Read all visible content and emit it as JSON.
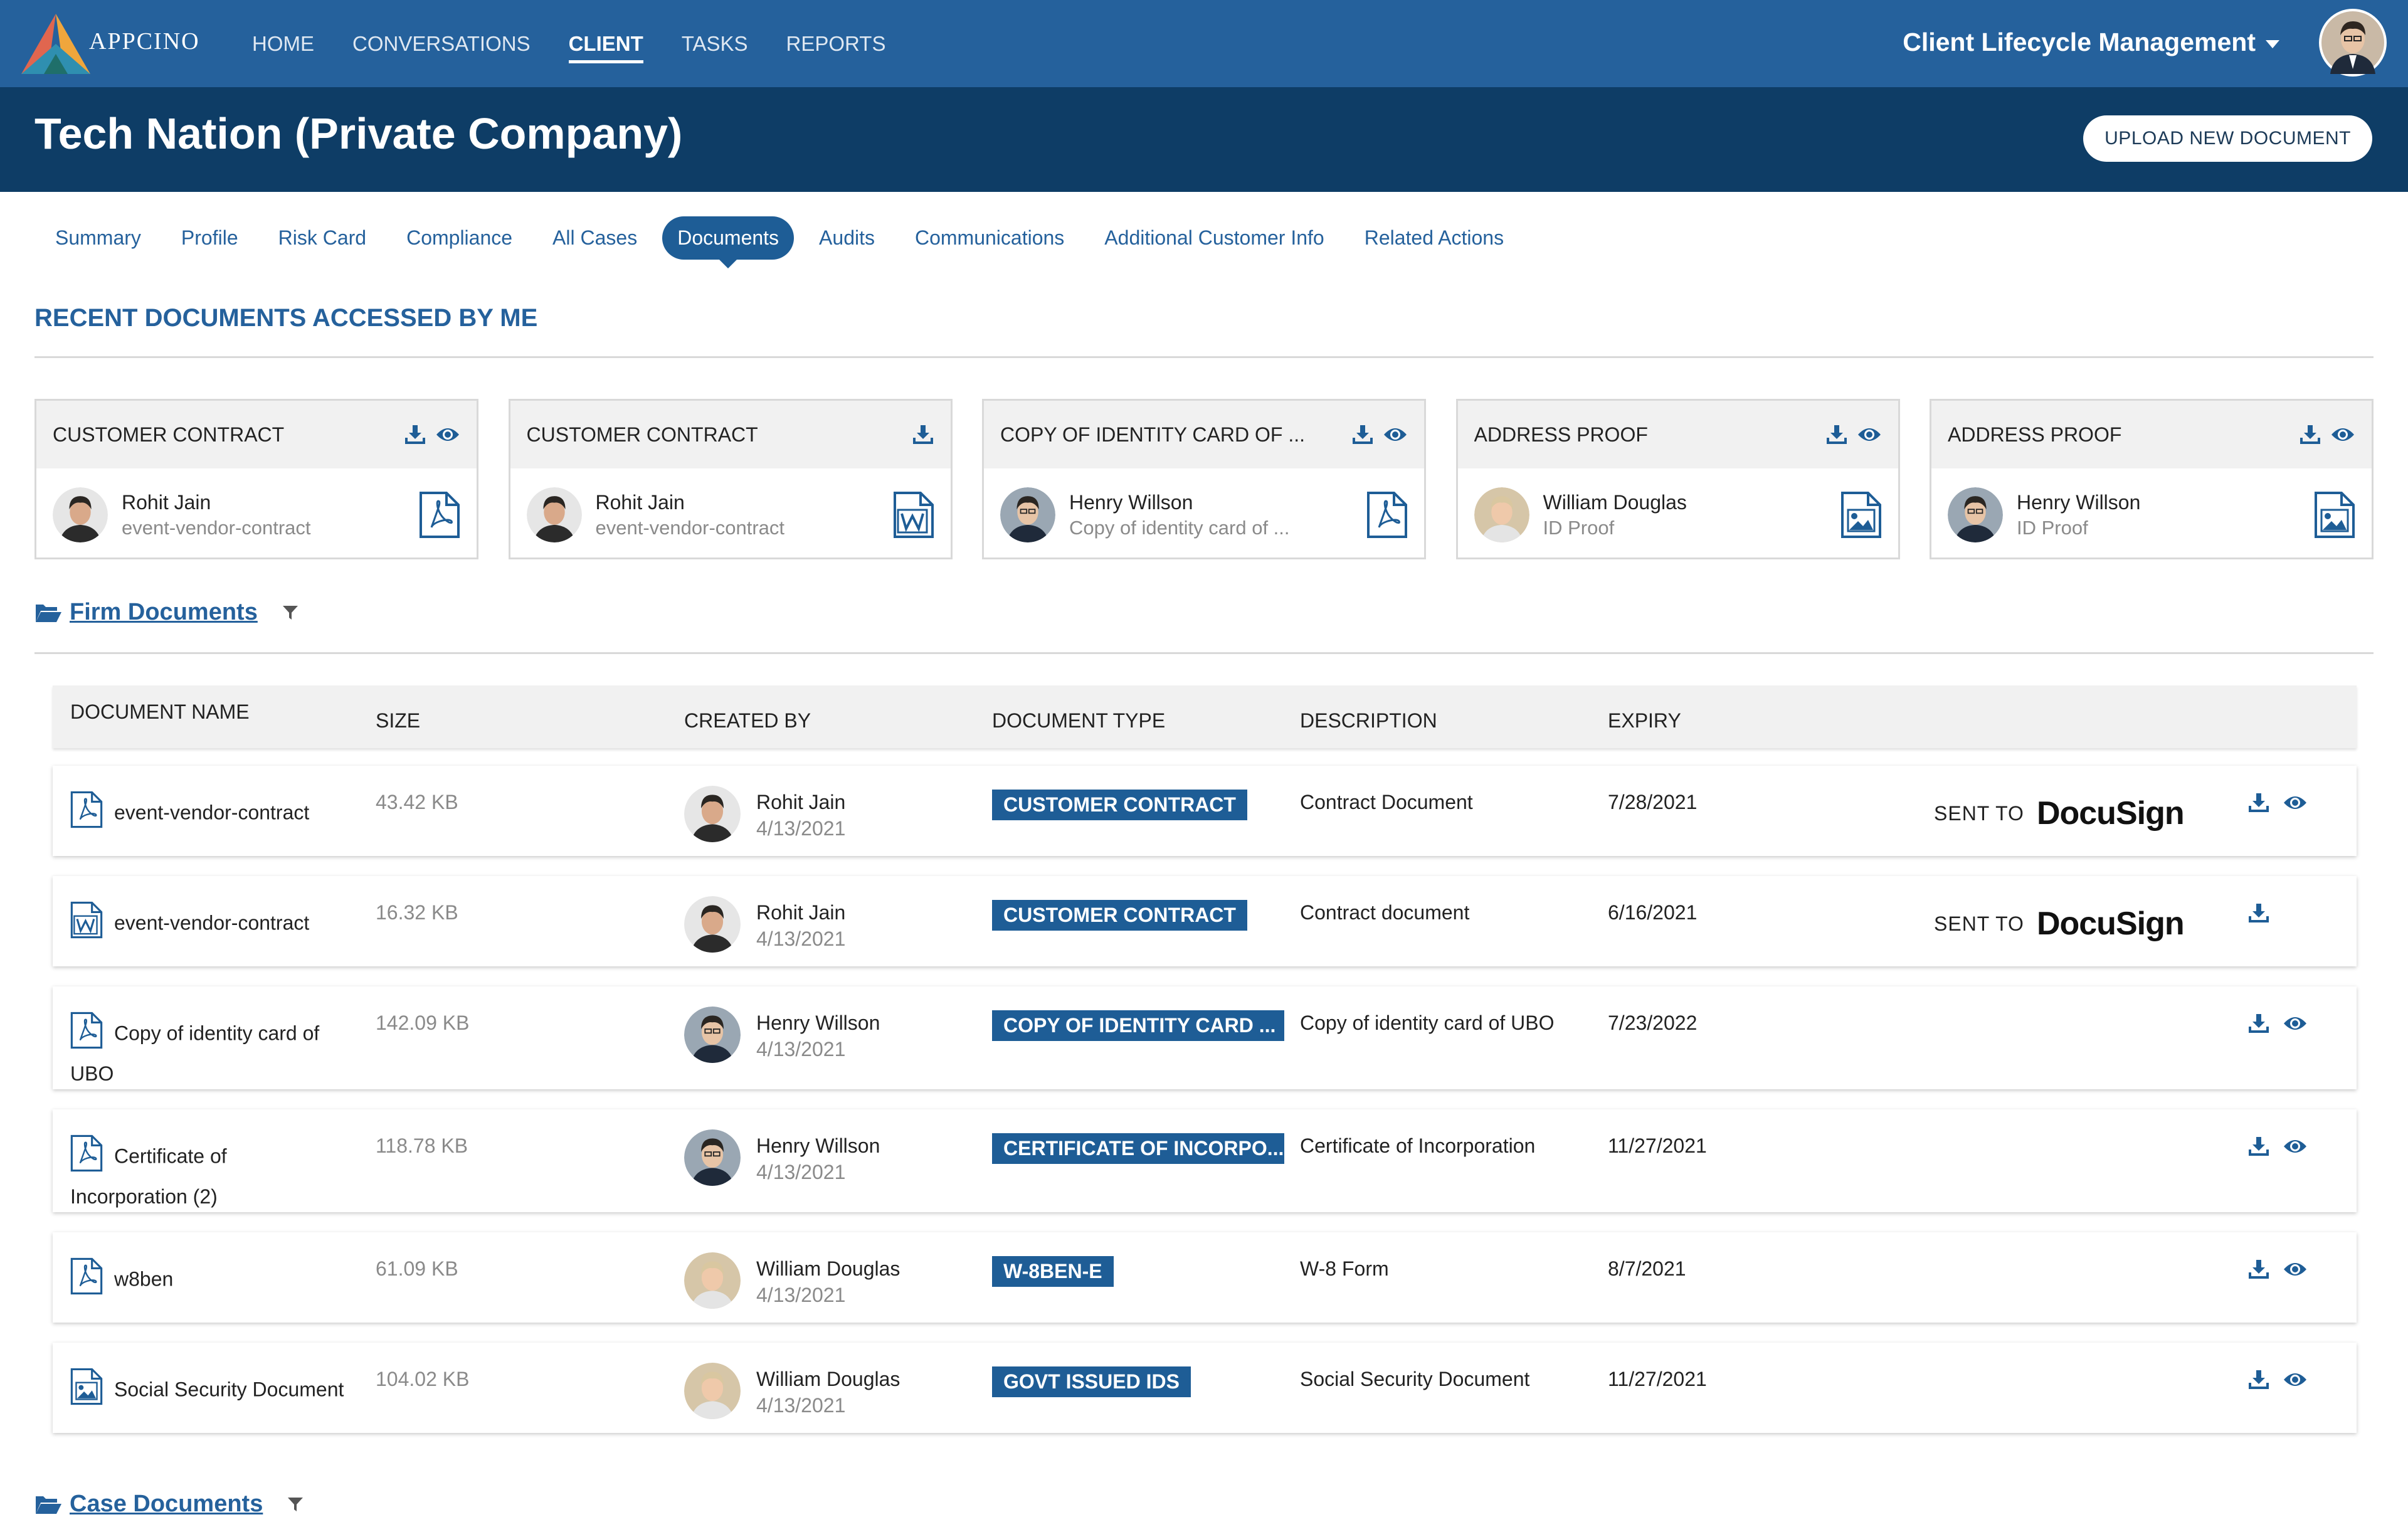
{
  "brand": {
    "name": "APPCINO"
  },
  "nav": [
    "HOME",
    "CONVERSATIONS",
    "CLIENT",
    "TASKS",
    "REPORTS"
  ],
  "app_switcher": "Client Lifecycle Management",
  "header": {
    "title": "Tech Nation (Private Company)",
    "upload_button": "UPLOAD NEW DOCUMENT"
  },
  "subtabs": [
    "Summary",
    "Profile",
    "Risk Card",
    "Compliance",
    "All Cases",
    "Documents",
    "Audits",
    "Communications",
    "Additional Customer Info",
    "Related Actions"
  ],
  "active_subtab": "Documents",
  "recent": {
    "title": "RECENT DOCUMENTS ACCESSED BY ME",
    "cards": [
      {
        "title": "CUSTOMER CONTRACT",
        "name": "Rohit Jain",
        "sub": "event-vendor-contract",
        "file_icon": "pdf-file-icon",
        "view": true
      },
      {
        "title": "CUSTOMER CONTRACT",
        "name": "Rohit Jain",
        "sub": "event-vendor-contract",
        "file_icon": "word-file-icon",
        "view": false
      },
      {
        "title": "COPY OF IDENTITY CARD OF ...",
        "name": "Henry Willson",
        "sub": "Copy of identity card of ...",
        "file_icon": "pdf-file-icon",
        "view": true
      },
      {
        "title": "ADDRESS PROOF",
        "name": "William Douglas",
        "sub": "ID Proof",
        "file_icon": "image-file-icon",
        "view": true
      },
      {
        "title": "ADDRESS PROOF",
        "name": "Henry Willson",
        "sub": "ID Proof",
        "file_icon": "image-file-icon",
        "view": true
      }
    ]
  },
  "firm_documents": {
    "label": "Firm Documents",
    "columns": [
      "DOCUMENT NAME",
      "SIZE",
      "CREATED BY",
      "DOCUMENT TYPE",
      "DESCRIPTION",
      "EXPIRY"
    ],
    "rows": [
      {
        "name_line1": "event-vendor-contract",
        "name_line2": "",
        "icon": "pdf-file-icon",
        "size": "43.42 KB",
        "creator": "Rohit Jain",
        "date": "4/13/2021",
        "type": "CUSTOMER CONTRACT",
        "description": "Contract Document",
        "expiry": "7/28/2021",
        "sent": true,
        "view": true
      },
      {
        "name_line1": "event-vendor-contract",
        "name_line2": "",
        "icon": "word-file-icon",
        "size": "16.32 KB",
        "creator": "Rohit Jain",
        "date": "4/13/2021",
        "type": "CUSTOMER CONTRACT",
        "description": "Contract document",
        "expiry": "6/16/2021",
        "sent": true,
        "view": false
      },
      {
        "name_line1": "Copy of identity card of",
        "name_line2": "UBO",
        "icon": "pdf-file-icon",
        "size": "142.09 KB",
        "creator": "Henry Willson",
        "date": "4/13/2021",
        "type": "COPY OF IDENTITY CARD ...",
        "description": "Copy of identity card of UBO",
        "expiry": "7/23/2022",
        "sent": false,
        "view": true
      },
      {
        "name_line1": "Certificate of",
        "name_line2": "Incorporation (2)",
        "icon": "pdf-file-icon",
        "size": "118.78 KB",
        "creator": "Henry Willson",
        "date": "4/13/2021",
        "type": "CERTIFICATE OF INCORPO...",
        "description": "Certificate of Incorporation",
        "expiry": "11/27/2021",
        "sent": false,
        "view": true
      },
      {
        "name_line1": "w8ben",
        "name_line2": "",
        "icon": "pdf-file-icon",
        "size": "61.09 KB",
        "creator": "William Douglas",
        "date": "4/13/2021",
        "type": "W-8BEN-E",
        "description": "W-8 Form",
        "expiry": "8/7/2021",
        "sent": false,
        "view": true
      },
      {
        "name_line1": "Social Security Document",
        "name_line2": "",
        "icon": "image-file-icon",
        "size": "104.02 KB",
        "creator": "William Douglas",
        "date": "4/13/2021",
        "type": "GOVT ISSUED IDS",
        "description": "Social Security Document",
        "expiry": "11/27/2021",
        "sent": false,
        "view": true
      }
    ],
    "sent_to_label": "SENT TO",
    "docusign_label": "DocuSign"
  },
  "case_documents": {
    "label": "Case Documents"
  },
  "colors": {
    "nav": "#25619c",
    "header": "#0e3d66",
    "accent": "#1e5d96"
  }
}
